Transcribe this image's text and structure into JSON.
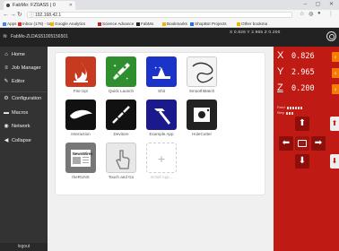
{
  "browser": {
    "tab_title": "FabMo: FZ0AS5 | 0",
    "url": "192.168.42.1",
    "bookmarks": [
      "Apps",
      "Inbox (178) - tool",
      "Google Analytics",
      "Science Advance",
      "FabMo",
      "Bookmarks",
      "ShopBot Projects",
      "Other bookma"
    ],
    "bookmark_colors": [
      "#4285f4",
      "#d93025",
      "#f4b400",
      "#c5221f",
      "#222222",
      "#f4b400",
      "#1a73e8",
      "#f4b400"
    ]
  },
  "app_header": {
    "title": "FabMo-ZLDAS51005156501",
    "coords": "X 0.826  Y 2.965  Z 0.200",
    "wifi_icon": "wifi-icon",
    "user_icon": "user-circle-icon"
  },
  "sidebar": {
    "items": [
      {
        "label": "Home",
        "icon": "home-icon",
        "glyph": "⌂"
      },
      {
        "label": "Job Manager",
        "icon": "job-manager-icon",
        "glyph": "≡"
      },
      {
        "label": "Editor",
        "icon": "pencil-icon",
        "glyph": "✎"
      },
      {
        "label": "Configuration",
        "icon": "gear-icon",
        "glyph": "⚙"
      },
      {
        "label": "Macros",
        "icon": "folder-icon",
        "glyph": "▬"
      },
      {
        "label": "Network",
        "icon": "wifi-icon",
        "glyph": "◉"
      },
      {
        "label": "Collapse",
        "icon": "collapse-icon",
        "glyph": "◀"
      }
    ],
    "logout_label": "logout"
  },
  "apps": [
    {
      "label": "Fire Up!",
      "color": "#c73a1f",
      "icon": "fire-icon"
    },
    {
      "label": "Quick Launch",
      "color": "#2f8f2f",
      "icon": "rocket-icon"
    },
    {
      "label": "Shit",
      "color": "#1a33c8",
      "icon": "sled-icon"
    },
    {
      "label": "SmoothMatch",
      "color": "#f4f4f4",
      "icon": "curve-icon"
    },
    {
      "label": "Interaction",
      "color": "#111111",
      "icon": "wing-icon"
    },
    {
      "label": "Devitore",
      "color": "#111111",
      "icon": "chain-icon"
    },
    {
      "label": "Example App",
      "color": "#1a1a8c",
      "icon": "hammer-icon"
    },
    {
      "label": "HoleCutter",
      "color": "#222222",
      "icon": "hole-cutter-icon"
    },
    {
      "label": "theRUNS",
      "color": "#777777",
      "icon": "newspaper-icon"
    },
    {
      "label": "Touch and Go",
      "color": "#e8e8e8",
      "icon": "touch-hand-icon"
    },
    {
      "label": "Install App...",
      "color": "#ffffff",
      "icon": "add-icon"
    }
  ],
  "jog": {
    "axes": [
      {
        "label": "X",
        "value": "0.826",
        "underline": false
      },
      {
        "label": "Y",
        "value": "2.965",
        "underline": false
      },
      {
        "label": "Z",
        "value": "0.200",
        "underline": true
      }
    ],
    "axis_button": "0",
    "feed_label": "Feed",
    "step_label": "Step",
    "up": "⬆",
    "down": "⬇",
    "left": "⬅",
    "right": "➡"
  }
}
